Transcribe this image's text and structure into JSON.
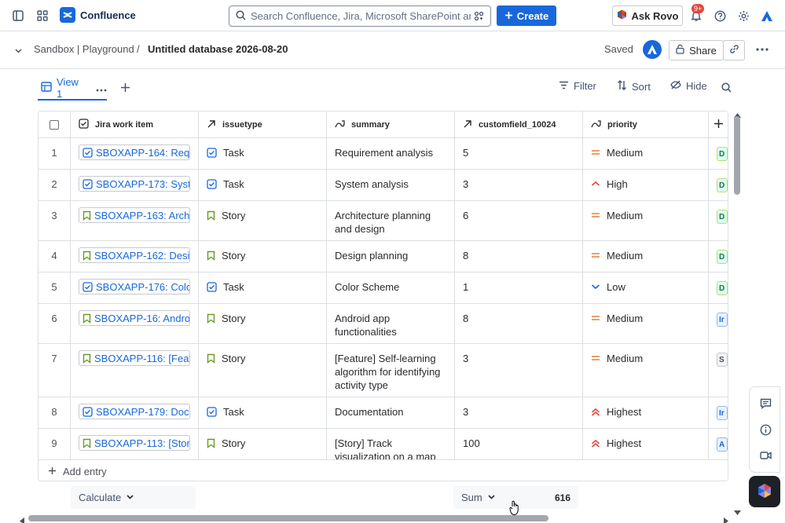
{
  "topbar": {
    "app_name": "Confluence",
    "search_placeholder": "Search Confluence, Jira, Microsoft SharePoint an...",
    "create_label": "Create",
    "rovo_label": "Ask Rovo",
    "notification_badge": "9+"
  },
  "breadcrumb": {
    "space": "Sandbox | Playground",
    "separator": "/",
    "page": "Untitled database 2026-08-20",
    "saved_status": "Saved",
    "share_label": "Share"
  },
  "viewbar": {
    "view_tab": "View 1",
    "filter_label": "Filter",
    "sort_label": "Sort",
    "hide_label": "Hide"
  },
  "table": {
    "columns": [
      "Jira work item",
      "issuetype",
      "summary",
      "customfield_10024",
      "priority"
    ],
    "rows": [
      {
        "n": "1",
        "item": "SBOXAPP-164: Requ...",
        "type": "Task",
        "summary": "Requirement analysis",
        "cf": "5",
        "priority": "Medium",
        "extra": "D"
      },
      {
        "n": "2",
        "item": "SBOXAPP-173: Syst...",
        "type": "Task",
        "summary": "System analysis",
        "cf": "3",
        "priority": "High",
        "extra": "D"
      },
      {
        "n": "3",
        "item": "SBOXAPP-163: Archi...",
        "type": "Story",
        "summary": "Architecture planning and design",
        "cf": "6",
        "priority": "Medium",
        "extra": "D"
      },
      {
        "n": "4",
        "item": "SBOXAPP-162: Desi...",
        "type": "Story",
        "summary": "Design planning",
        "cf": "8",
        "priority": "Medium",
        "extra": "D"
      },
      {
        "n": "5",
        "item": "SBOXAPP-176: Color...",
        "type": "Task",
        "summary": "Color Scheme",
        "cf": "1",
        "priority": "Low",
        "extra": "D"
      },
      {
        "n": "6",
        "item": "SBOXAPP-16: Androi...",
        "type": "Story",
        "summary": "Android app functionalities",
        "cf": "8",
        "priority": "Medium",
        "extra": "Ir"
      },
      {
        "n": "7",
        "item": "SBOXAPP-116: [Feat...",
        "type": "Story",
        "summary": "[Feature] Self-learning algorithm for identifying activity type",
        "cf": "3",
        "priority": "Medium",
        "extra": "S"
      },
      {
        "n": "8",
        "item": "SBOXAPP-179: Docu...",
        "type": "Task",
        "summary": "Documentation",
        "cf": "3",
        "priority": "Highest",
        "extra": "Ir"
      },
      {
        "n": "9",
        "item": "SBOXAPP-113: [Stor...",
        "type": "Story",
        "summary": "[Story] Track visualization on a map",
        "cf": "100",
        "priority": "Highest",
        "extra": "A"
      }
    ],
    "add_entry_label": "Add entry"
  },
  "footer": {
    "calculate_label": "Calculate",
    "sum_label": "Sum",
    "sum_value": "616"
  },
  "colors": {
    "accent": "#1868db",
    "task_icon": "#1868db",
    "story_icon": "#6a9a23",
    "medium": "#e2803a",
    "high_highest": "#e2483d",
    "low": "#1868db"
  }
}
